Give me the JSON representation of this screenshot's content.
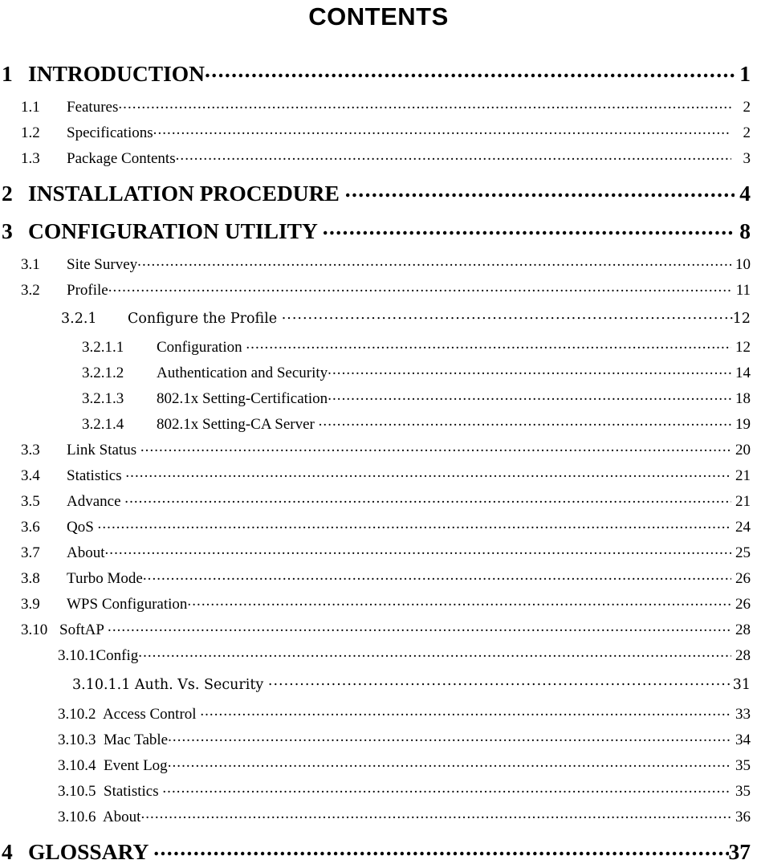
{
  "document": {
    "title": "CONTENTS"
  },
  "toc": {
    "entries": [
      {
        "level": 1,
        "number": "1",
        "label": "INTRODUCTION",
        "page": "1"
      },
      {
        "level": 2,
        "number": "1.1",
        "label": "Features",
        "page": "2"
      },
      {
        "level": 2,
        "number": "1.2",
        "label": "Specifications",
        "page": "2"
      },
      {
        "level": 2,
        "number": "1.3",
        "label": "Package Contents",
        "page": "3"
      },
      {
        "level": 1,
        "number": "2",
        "label": "INSTALLATION PROCEDURE ",
        "page": "4"
      },
      {
        "level": 1,
        "number": "3",
        "label": "CONFIGURATION UTILITY ",
        "page": "8"
      },
      {
        "level": 2,
        "number": "3.1",
        "label": "Site Survey",
        "page": "10"
      },
      {
        "level": 2,
        "number": "3.2",
        "label": "Profile",
        "page": "11"
      },
      {
        "level": 3,
        "number": "3.2.1",
        "label": "Configure the Profile ",
        "page": "12"
      },
      {
        "level": 4,
        "number": "3.2.1.1",
        "label": "Configuration ",
        "page": "12"
      },
      {
        "level": 4,
        "number": "3.2.1.2",
        "label": "Authentication and Security",
        "page": "14"
      },
      {
        "level": 4,
        "number": "3.2.1.3",
        "label": "802.1x Setting-Certification",
        "page": "18"
      },
      {
        "level": 4,
        "number": "3.2.1.4",
        "label": "802.1x Setting-CA Server ",
        "page": "19"
      },
      {
        "level": 2,
        "number": "3.3",
        "label": "Link Status ",
        "page": "20"
      },
      {
        "level": 2,
        "number": "3.4",
        "label": "Statistics ",
        "page": "21"
      },
      {
        "level": 2,
        "number": "3.5",
        "label": "Advance ",
        "page": "21"
      },
      {
        "level": 2,
        "number": "3.6",
        "label": "QoS ",
        "page": "24"
      },
      {
        "level": 2,
        "number": "3.7",
        "label": "About",
        "page": "25"
      },
      {
        "level": 2,
        "number": "3.8",
        "label": "Turbo Mode",
        "page": "26"
      },
      {
        "level": 2,
        "number": "3.9",
        "label": "WPS Configuration",
        "page": "26"
      },
      {
        "level": 2,
        "number": "3.10",
        "label": "SoftAP ",
        "page": "28",
        "wide": true
      },
      {
        "level": 3,
        "number": "",
        "label": "3.10.1Config",
        "page": "28",
        "style": "lv3b"
      },
      {
        "level": 4,
        "number": "",
        "label": "3.10.1.1 Auth. Vs. Security ",
        "page": "31",
        "style": "lv4b"
      },
      {
        "level": 3,
        "number": "",
        "label": "3.10.2  Access Control ",
        "page": "33",
        "style": "lv3b"
      },
      {
        "level": 3,
        "number": "",
        "label": "3.10.3  Mac Table",
        "page": "34",
        "style": "lv3b"
      },
      {
        "level": 3,
        "number": "",
        "label": "3.10.4  Event Log",
        "page": "35",
        "style": "lv3b"
      },
      {
        "level": 3,
        "number": "",
        "label": "3.10.5  Statistics ",
        "page": "35",
        "style": "lv3b"
      },
      {
        "level": 3,
        "number": "",
        "label": "3.10.6  About",
        "page": "36",
        "style": "lv3b"
      },
      {
        "level": 1,
        "number": "4",
        "label": "GLOSSARY ",
        "page": "37"
      }
    ]
  }
}
